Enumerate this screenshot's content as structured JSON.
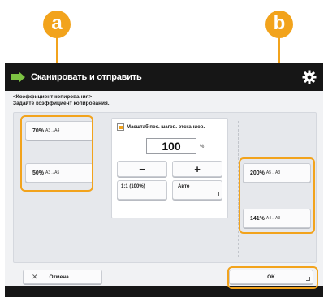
{
  "callouts": {
    "a": "a",
    "b": "b"
  },
  "titlebar": {
    "title": "Сканировать и отправить",
    "icon": "scan-send-arrow-icon",
    "settings_icon": "gear-icon"
  },
  "subtitle": {
    "line1": "<Коэффициент копирования>",
    "line2": "Задайте коэффициент копирования."
  },
  "preset_left": [
    {
      "label": "70%",
      "sub": "A3→A4"
    },
    {
      "label": "50%",
      "sub": "A3→A5"
    }
  ],
  "manual": {
    "label": "Масштаб пос. шагов. отсканиов.",
    "value": "100",
    "unit": "%",
    "minus": "−",
    "plus": "+",
    "one_to_one": "1:1 (100%)",
    "auto": "Авто"
  },
  "preset_right": [
    {
      "label": "200%",
      "sub": "A5→A3"
    },
    {
      "label": "141%",
      "sub": "A4→A3"
    }
  ],
  "buttons": {
    "cancel": "Отмена",
    "cancel_icon": "close-icon",
    "ok": "OK"
  },
  "colors": {
    "accent": "#f2a31c",
    "titlebar": "#161616",
    "panel_bg": "#f1f2f4"
  }
}
